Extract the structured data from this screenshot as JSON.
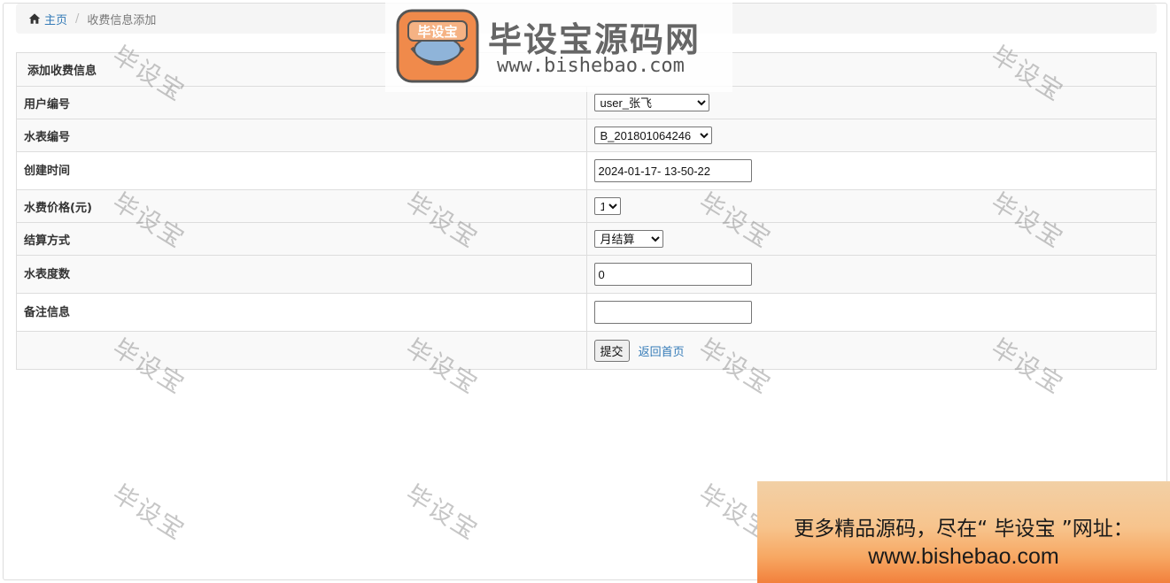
{
  "breadcrumb": {
    "home_label": "主页",
    "current_label": "收费信息添加"
  },
  "form": {
    "title": "添加收费信息",
    "user_label": "用户编号",
    "user_value": "user_张飞",
    "meter_label": "水表编号",
    "meter_value": "B_201801064246",
    "created_label": "创建时间",
    "created_value": "2024-01-17- 13-50-22",
    "price_label": "水费价格(元)",
    "price_value": "1",
    "settle_label": "结算方式",
    "settle_value": "月结算",
    "reading_label": "水表度数",
    "reading_value": "0",
    "remark_label": "备注信息",
    "remark_value": "",
    "submit_label": "提交",
    "back_label": "返回首页"
  },
  "watermark": {
    "text": "毕设宝"
  },
  "logo": {
    "badge_text": "毕设宝",
    "title": "毕设宝源码网",
    "url": "www.bishebao.com"
  },
  "ad": {
    "line1": "更多精品源码，尽在“ 毕设宝 ”网址：",
    "line2": "www.bishebao.com"
  },
  "colors": {
    "link": "#337ab7",
    "row_alt": "#f9f9f9",
    "border": "#dddddd",
    "logo_orange": "#f08a4b"
  }
}
